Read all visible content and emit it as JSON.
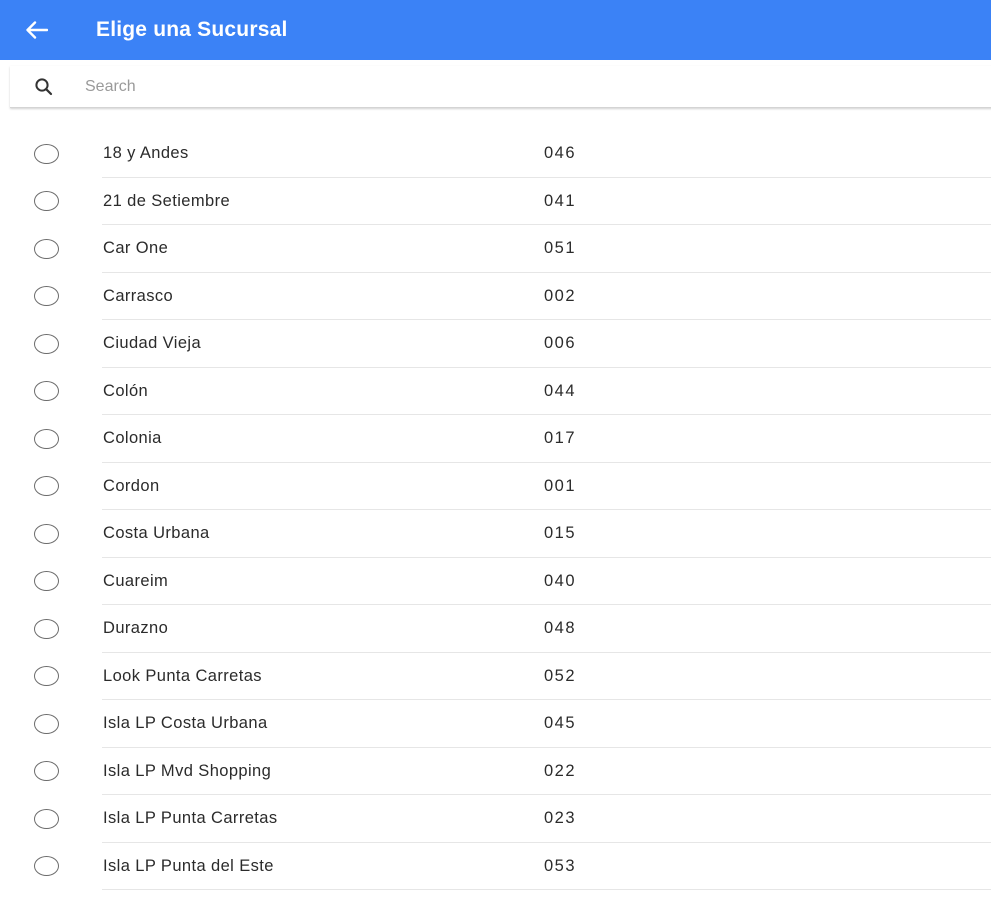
{
  "header": {
    "title": "Elige una Sucursal",
    "back_icon": "arrow-left-icon",
    "color": "#3b82f6"
  },
  "search": {
    "placeholder": "Search",
    "value": "",
    "icon": "search-icon"
  },
  "branches": [
    {
      "name": "18 y Andes",
      "code": "046"
    },
    {
      "name": "21 de Setiembre",
      "code": "041"
    },
    {
      "name": "Car One",
      "code": "051"
    },
    {
      "name": "Carrasco",
      "code": "002"
    },
    {
      "name": "Ciudad Vieja",
      "code": "006"
    },
    {
      "name": "Colón",
      "code": "044"
    },
    {
      "name": "Colonia",
      "code": "017"
    },
    {
      "name": "Cordon",
      "code": "001"
    },
    {
      "name": "Costa Urbana",
      "code": "015"
    },
    {
      "name": "Cuareim",
      "code": "040"
    },
    {
      "name": "Durazno",
      "code": "048"
    },
    {
      "name": "Look Punta Carretas",
      "code": "052"
    },
    {
      "name": "Isla LP Costa Urbana",
      "code": "045"
    },
    {
      "name": "Isla LP Mvd Shopping",
      "code": "022"
    },
    {
      "name": "Isla LP Punta Carretas",
      "code": "023"
    },
    {
      "name": "Isla LP Punta del Este",
      "code": "053"
    }
  ]
}
